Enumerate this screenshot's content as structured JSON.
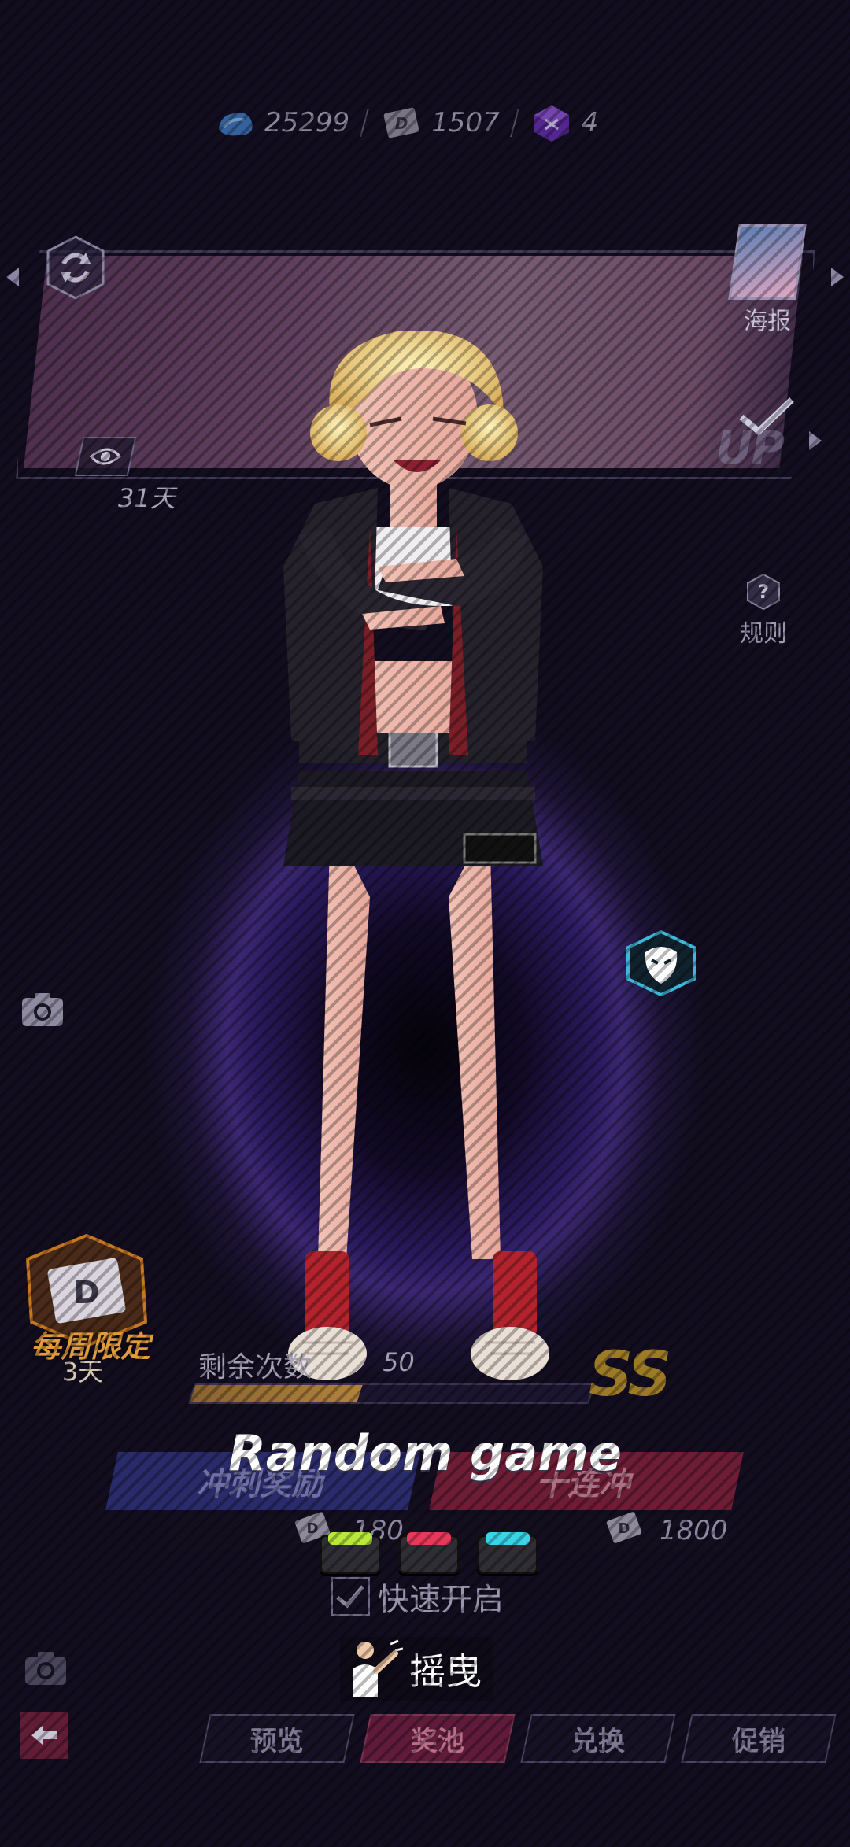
{
  "currencies": [
    {
      "icon": "blue-cloud-currency-icon",
      "value": "25299"
    },
    {
      "icon": "d-ticket-icon",
      "value": "1507"
    },
    {
      "icon": "purple-cube-icon",
      "value": "4"
    }
  ],
  "banner": {
    "poster_label": "海报",
    "days_left": "31天",
    "up_label": "UP",
    "rules_label": "规则"
  },
  "weekly": {
    "label": "每周限定",
    "days": "3天"
  },
  "gacha": {
    "remaining_label": "剩余次数",
    "remaining_value": "50",
    "progress": 0.42,
    "rank": "SS",
    "title": "Random game",
    "left_button": "冲刺奖励",
    "right_button": "十连冲",
    "left_cost": "180",
    "right_cost": "1800",
    "quick_start": "快速开启",
    "shake": "摇曳"
  },
  "color_buttons": [
    {
      "name": "green",
      "color": "#b8e83a"
    },
    {
      "name": "red",
      "color": "#e8395a"
    },
    {
      "name": "cyan",
      "color": "#3ad4e8"
    }
  ],
  "tabs": [
    {
      "label": "预览",
      "active": false
    },
    {
      "label": "奖池",
      "active": true
    },
    {
      "label": "兑换",
      "active": false
    },
    {
      "label": "促销",
      "active": false
    }
  ]
}
